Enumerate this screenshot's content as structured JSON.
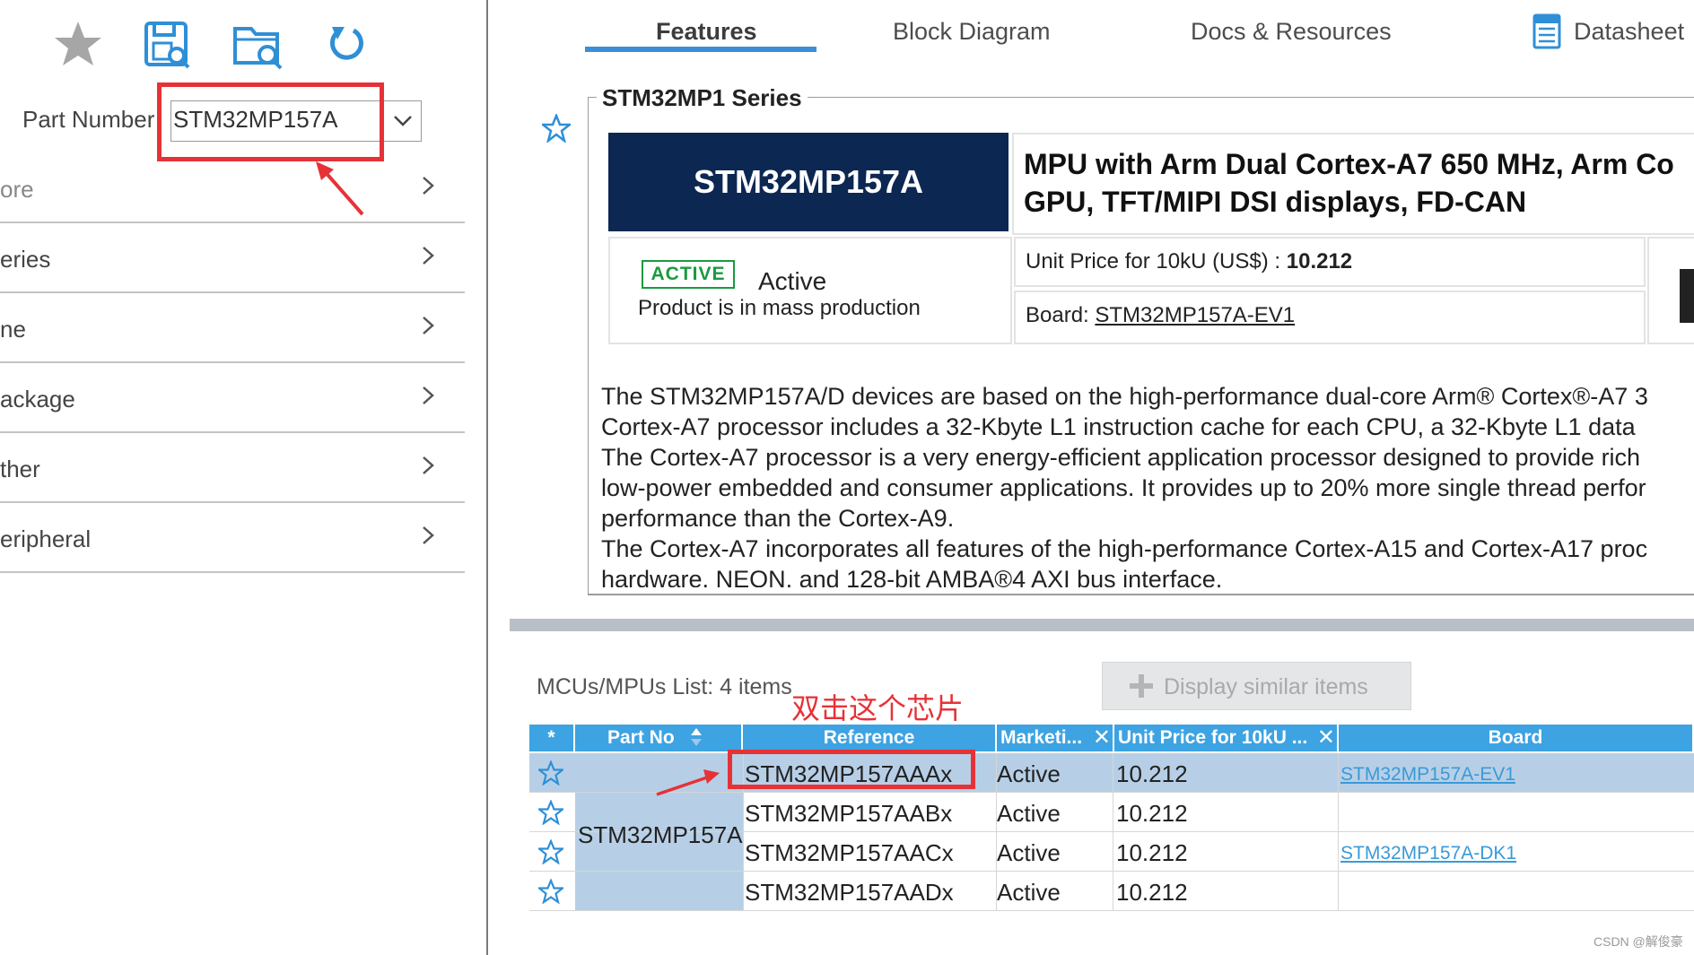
{
  "left": {
    "toolbar": [
      "star-icon",
      "save-search-icon",
      "open-search-icon",
      "refresh-icon"
    ],
    "part_number_label": "Part Number",
    "part_number_value": "STM32MP157A",
    "filters": [
      "ore",
      "eries",
      "ne",
      "ackage",
      "ther",
      "eripheral"
    ]
  },
  "tabs": [
    "Features",
    "Block Diagram",
    "Docs & Resources",
    "Datasheet"
  ],
  "series": {
    "title": "STM32MP1 Series",
    "part_name": "STM32MP157A",
    "desc_line1": "MPU with Arm Dual Cortex-A7 650 MHz, Arm Co",
    "desc_line2": "GPU, TFT/MIPI DSI displays, FD-CAN",
    "status_badge": "ACTIVE",
    "status_text": "Active",
    "status_sub": "Product is in mass production",
    "price_label": "Unit Price for 10kU (US$) :",
    "price_value": "10.212",
    "board_label": "Board:",
    "board_value": "STM32MP157A-EV1",
    "paragraph": [
      "The STM32MP157A/D devices are based on the high-performance dual-core Arm® Cortex®-A7 3",
      "Cortex-A7 processor includes a 32-Kbyte L1 instruction cache for each CPU, a 32-Kbyte L1 data",
      "The Cortex-A7 processor is a very energy-efficient application processor designed to provide rich",
      "low-power embedded and consumer applications. It provides up to 20% more single thread perfor",
      "performance than the Cortex-A9.",
      "The Cortex-A7 incorporates all features of the high-performance Cortex-A15 and Cortex-A17 proc",
      "hardware, NEON, and 128-bit AMBA®4 AXI bus interface."
    ]
  },
  "list": {
    "title": "MCUs/MPUs List: 4 items",
    "similar_button": "Display similar items",
    "annotation": "双击这个芯片",
    "headers": [
      "*",
      "Part No",
      "Reference",
      "Marketi...",
      "Unit Price for 10kU ...",
      "Board"
    ],
    "part_no": "STM32MP157A",
    "rows": [
      {
        "reference": "STM32MP157AAAx",
        "marketing": "Active",
        "price": "10.212",
        "board": "STM32MP157A-EV1"
      },
      {
        "reference": "STM32MP157AABx",
        "marketing": "Active",
        "price": "10.212",
        "board": ""
      },
      {
        "reference": "STM32MP157AACx",
        "marketing": "Active",
        "price": "10.212",
        "board": "STM32MP157A-DK1"
      },
      {
        "reference": "STM32MP157AADx",
        "marketing": "Active",
        "price": "10.212",
        "board": ""
      }
    ]
  },
  "watermark": "CSDN @解俊豪",
  "colors": {
    "accent": "#3da3e2",
    "highlight": "#e63237",
    "selected_row": "#b7cfe6",
    "dark_card": "#0c2752"
  }
}
